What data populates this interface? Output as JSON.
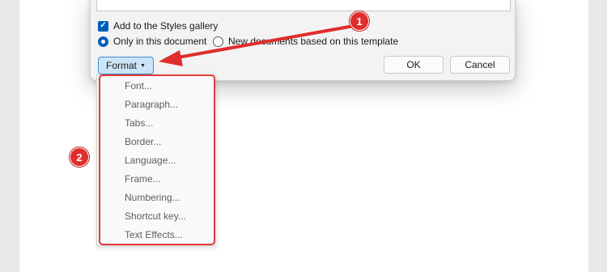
{
  "dialog": {
    "add_to_gallery": {
      "label": "Add to the Styles gallery",
      "checked": true
    },
    "scope_options": [
      {
        "label": "Only in this document",
        "selected": true
      },
      {
        "label": "New documents based on this template",
        "selected": false
      }
    ],
    "format_button": "Format",
    "ok_button": "OK",
    "cancel_button": "Cancel"
  },
  "format_menu": {
    "items": [
      "Font...",
      "Paragraph...",
      "Tabs...",
      "Border...",
      "Language...",
      "Frame...",
      "Numbering...",
      "Shortcut key...",
      "Text Effects..."
    ]
  },
  "annotations": {
    "step1": "1",
    "step2": "2",
    "accent_color": "#e02d2d"
  },
  "icons": {
    "checkbox": "check-icon",
    "dropdown": "caret-down-icon",
    "arrow": "pointer-arrow-icon"
  }
}
